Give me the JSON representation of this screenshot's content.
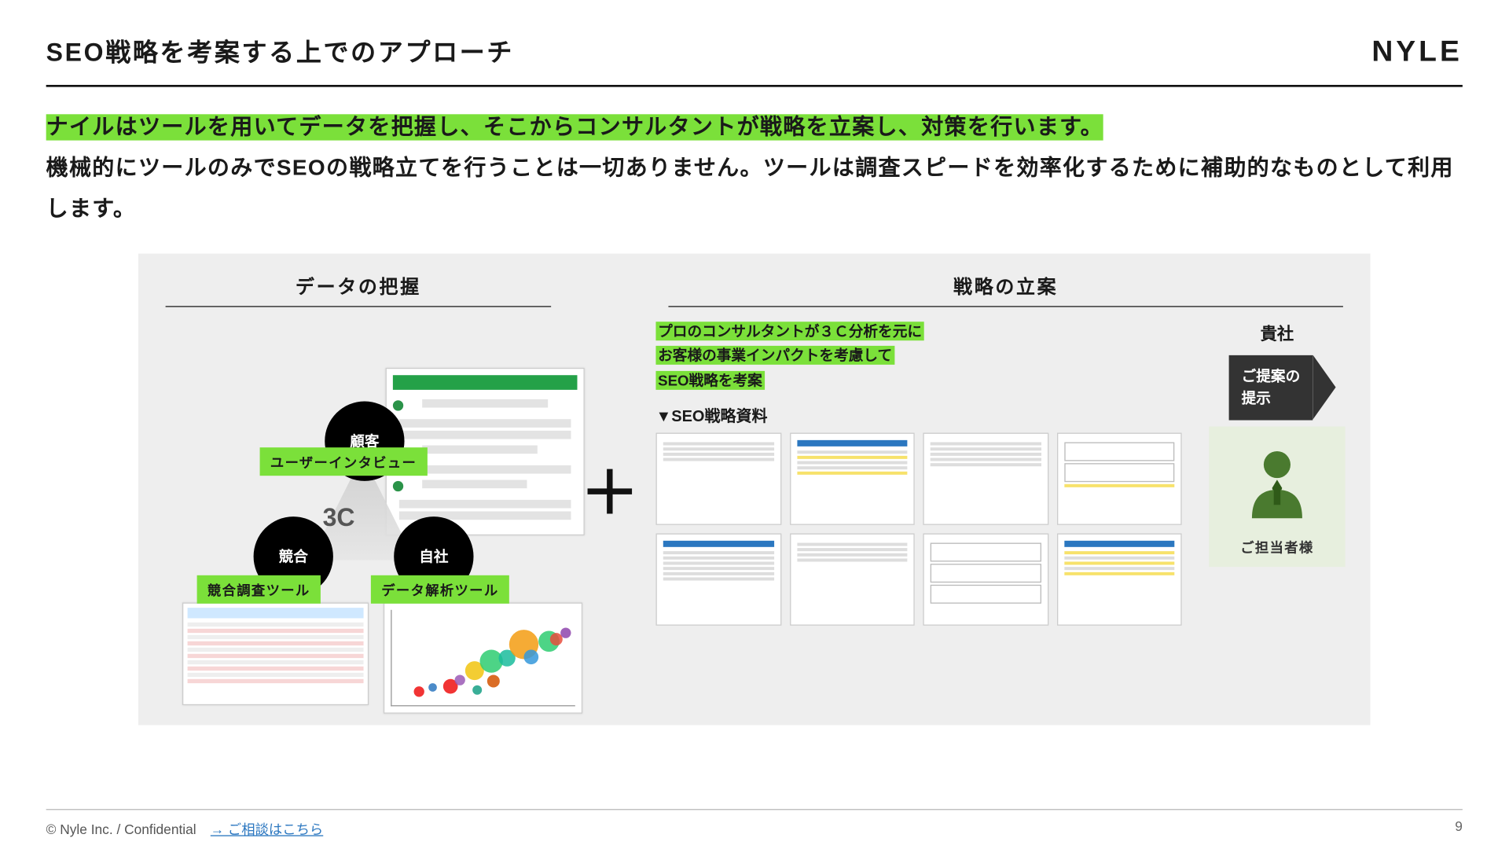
{
  "header": {
    "title": "SEO戦略を考案する上でのアプローチ",
    "logo": "NYLE"
  },
  "intro": {
    "highlight": "ナイルはツールを用いてデータを把握し、そこからコンサルタントが戦略を立案し、対策を行います。",
    "rest": "機械的にツールのみでSEOの戦略立てを行うことは一切ありません。ツールは調査スピードを効率化するために補助的なものとして利用します。"
  },
  "left": {
    "heading": "データの把握",
    "c_label": "3C",
    "circles": {
      "top": "顧客",
      "left": "競合",
      "right": "自社"
    },
    "tags": {
      "top": "ユーザーインタビュー",
      "left": "競合調査ツール",
      "right": "データ解析ツール"
    }
  },
  "plus": "＋",
  "right": {
    "heading": "戦略の立案",
    "hl1": "プロのコンサルタントが３Ｃ分析を元に",
    "hl2": "お客様の事業インパクトを考慮して",
    "hl3": "SEO戦略を考案",
    "deck_title": "▼SEO戦略資料"
  },
  "client": {
    "title": "貴社",
    "arrow_l1": "ご提案の",
    "arrow_l2": "提示",
    "person_label": "ご担当者様"
  },
  "footer": {
    "left": "© Nyle Inc. / Confidential",
    "link": "→ ご相談はこちら",
    "page": "9"
  },
  "bubbles": [
    {
      "l": 12,
      "b": 8,
      "s": 10,
      "c": "#e11"
    },
    {
      "l": 20,
      "b": 14,
      "s": 8,
      "c": "#2b77c0"
    },
    {
      "l": 28,
      "b": 12,
      "s": 14,
      "c": "#e11"
    },
    {
      "l": 34,
      "b": 20,
      "s": 10,
      "c": "#9b59b6"
    },
    {
      "l": 40,
      "b": 26,
      "s": 18,
      "c": "#f1c40f"
    },
    {
      "l": 48,
      "b": 34,
      "s": 22,
      "c": "#2ecc71"
    },
    {
      "l": 58,
      "b": 40,
      "s": 16,
      "c": "#1abc9c"
    },
    {
      "l": 64,
      "b": 48,
      "s": 28,
      "c": "#f39c12"
    },
    {
      "l": 72,
      "b": 42,
      "s": 14,
      "c": "#3498db"
    },
    {
      "l": 80,
      "b": 56,
      "s": 20,
      "c": "#2ecc71"
    },
    {
      "l": 86,
      "b": 62,
      "s": 12,
      "c": "#e74c3c"
    },
    {
      "l": 92,
      "b": 70,
      "s": 10,
      "c": "#8e44ad"
    },
    {
      "l": 52,
      "b": 18,
      "s": 12,
      "c": "#d35400"
    },
    {
      "l": 44,
      "b": 10,
      "s": 9,
      "c": "#16a085"
    }
  ]
}
